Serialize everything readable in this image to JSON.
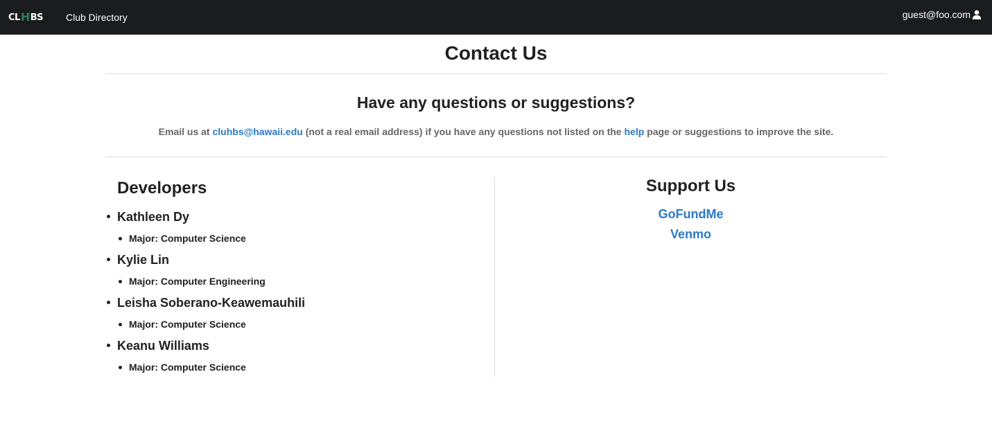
{
  "navbar": {
    "logo_left": "CL",
    "logo_mark": "H",
    "logo_right": "BS",
    "directory_link": "Club Directory",
    "user_email": "guest@foo.com"
  },
  "page": {
    "title": "Contact Us",
    "subtitle": "Have any questions or suggestions?",
    "intro": {
      "prefix": "Email us at ",
      "email_link": "cluhbs@hawaii.edu",
      "middle": " (not a real email address) if you have any questions not listed on the ",
      "help_link": "help",
      "suffix": " page or suggestions to improve the site."
    }
  },
  "developers": {
    "heading": "Developers",
    "items": [
      {
        "name": "Kathleen Dy",
        "major": "Major: Computer Science"
      },
      {
        "name": "Kylie Lin",
        "major": "Major: Computer Engineering"
      },
      {
        "name": "Leisha Soberano-Keawemauhili",
        "major": "Major: Computer Science"
      },
      {
        "name": "Keanu Williams",
        "major": "Major: Computer Science"
      }
    ]
  },
  "support": {
    "heading": "Support Us",
    "links": [
      "GoFundMe",
      "Venmo"
    ]
  },
  "colors": {
    "navbar_bg": "#1b1c1d",
    "link": "#2a7ac8",
    "logo_accent": "#2e7d5b"
  },
  "icons": {
    "user": "user-icon"
  }
}
